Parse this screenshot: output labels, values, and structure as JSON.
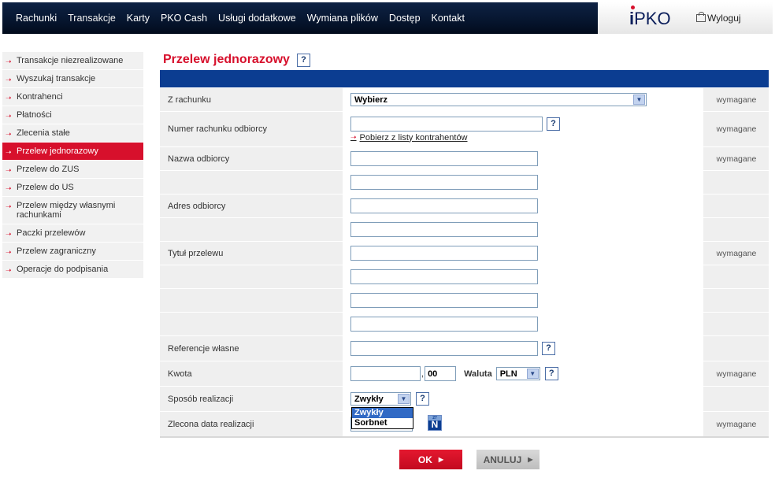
{
  "topnav": {
    "items": [
      "Rachunki",
      "Transakcje",
      "Karty",
      "PKO Cash",
      "Usługi dodatkowe",
      "Wymiana plików",
      "Dostęp",
      "Kontakt"
    ],
    "active_index": 1
  },
  "brand": {
    "logo_i": "i",
    "logo_rest": "PKO",
    "logout_label": "Wyloguj"
  },
  "sidebar": {
    "items": [
      "Transakcje niezrealizowane",
      "Wyszukaj transakcje",
      "Kontrahenci",
      "Płatności",
      "Zlecenia stałe",
      "Przelew jednorazowy",
      "Przelew do ZUS",
      "Przelew do US",
      "Przelew między własnymi rachunkami",
      "Paczki przelewów",
      "Przelew zagraniczny",
      "Operacje do podpisania"
    ],
    "active_index": 5
  },
  "page": {
    "title": "Przelew jednorazowy",
    "help": "?"
  },
  "form": {
    "required_label": "wymagane",
    "from_account": {
      "label": "Z rachunku",
      "value": "Wybierz"
    },
    "account_number": {
      "label": "Numer rachunku odbiorcy",
      "link": "Pobierz z listy kontrahentów"
    },
    "recipient_name": {
      "label": "Nazwa odbiorcy"
    },
    "recipient_address": {
      "label": "Adres odbiorcy"
    },
    "transfer_title": {
      "label": "Tytuł przelewu"
    },
    "own_reference": {
      "label": "Referencje własne"
    },
    "amount": {
      "label": "Kwota",
      "separator": ",",
      "cents": "00",
      "currency_label": "Waluta",
      "currency": "PLN"
    },
    "method": {
      "label": "Sposób realizacji",
      "value": "Zwykły",
      "options": [
        "Zwykły",
        "Sorbnet"
      ]
    },
    "date": {
      "label": "Zlecona data realizacji",
      "calendar_top": "27",
      "calendar_letter": "N"
    }
  },
  "buttons": {
    "ok": "OK",
    "cancel": "ANULUJ"
  },
  "colors": {
    "accent_red": "#d7102c",
    "nav_dark": "#06152e",
    "header_blue": "#0b3d91"
  }
}
